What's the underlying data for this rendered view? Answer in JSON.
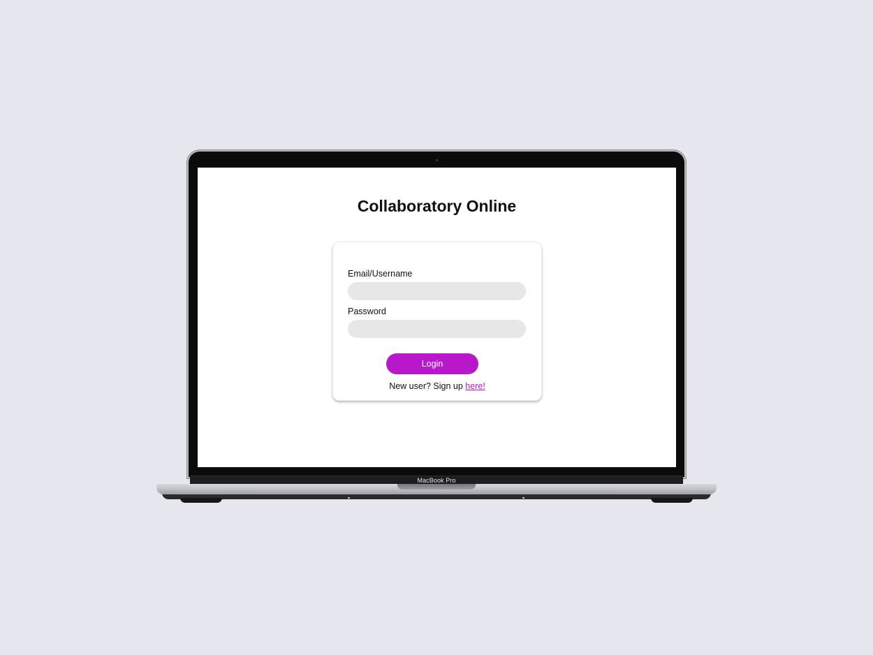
{
  "app": {
    "title": "Collaboratory Online"
  },
  "login_form": {
    "email_label": "Email/Username",
    "email_value": "",
    "password_label": "Password",
    "password_value": "",
    "submit_label": "Login",
    "signup_prompt": "New user? Sign up",
    "signup_link_label": "here!"
  },
  "device": {
    "model_label": "MacBook Pro"
  },
  "colors": {
    "accent": "#b818c9",
    "input_background": "#e7e7e7",
    "page_background": "#e6e7ee"
  }
}
